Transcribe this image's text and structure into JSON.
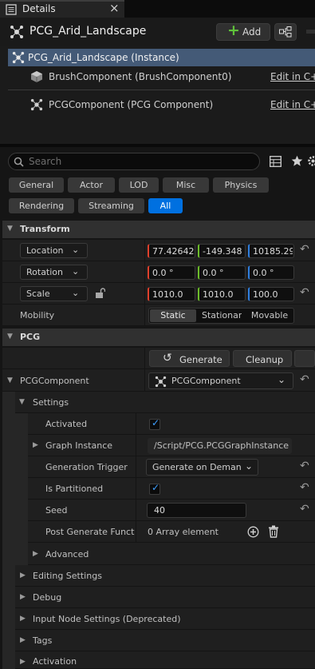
{
  "tab": {
    "title": "Details",
    "close": "×"
  },
  "header": {
    "actor_name": "PCG_Arid_Landscape",
    "add_label": "Add",
    "add_glyph": "+"
  },
  "tree": {
    "root": "PCG_Arid_Landscape (Instance)",
    "items": [
      {
        "label": "BrushComponent (BrushComponent0)",
        "edit": "Edit in C++"
      },
      {
        "label": "PCGComponent (PCG Component)",
        "edit": "Edit in C++"
      }
    ]
  },
  "search": {
    "placeholder": "Search"
  },
  "filters": [
    "General",
    "Actor",
    "LOD",
    "Misc",
    "Physics",
    "Rendering",
    "Streaming",
    "All"
  ],
  "transform": {
    "title": "Transform",
    "location": {
      "label": "Location",
      "x": "77.426422",
      "y": "-149.348",
      "z": "10185.29"
    },
    "rotation": {
      "label": "Rotation",
      "x": "0.0 °",
      "y": "0.0 °",
      "z": "0.0 °"
    },
    "scale": {
      "label": "Scale",
      "x": "1010.0",
      "y": "1010.0",
      "z": "100.0"
    },
    "mobility": {
      "label": "Mobility",
      "options": [
        "Static",
        "Stationary",
        "Movable"
      ]
    }
  },
  "pcg": {
    "title": "PCG",
    "generate": "Generate",
    "cleanup": "Cleanup",
    "component_label": "PCGComponent",
    "component_value": "PCGComponent",
    "settings": "Settings",
    "activated": "Activated",
    "graph_instance": "Graph Instance",
    "graph_instance_value": "/Script/PCG.PCGGraphInstance'",
    "generation_trigger": "Generation Trigger",
    "generation_trigger_value": "Generate on Demand",
    "is_partitioned": "Is Partitioned",
    "seed": "Seed",
    "seed_value": "40",
    "post_generate": "Post Generate Functi...",
    "post_generate_value": "0 Array element",
    "advanced": "Advanced",
    "sections": [
      "Editing Settings",
      "Debug",
      "Input Node Settings (Deprecated)",
      "Tags",
      "Activation"
    ]
  },
  "colors": {
    "accent": "#0070e0",
    "x_axis": "#e0402c",
    "y_axis": "#6cbd2a",
    "z_axis": "#2f7fe0",
    "add_plus": "#5fc13a"
  }
}
